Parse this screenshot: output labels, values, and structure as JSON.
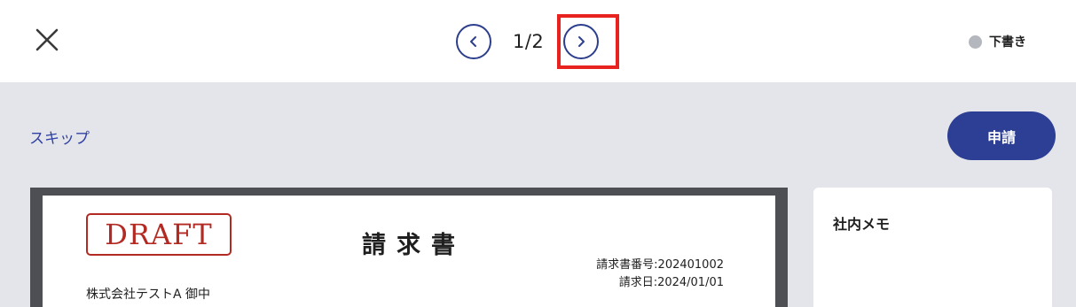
{
  "header": {
    "close_icon": "close-icon",
    "pager": {
      "prev_icon": "chevron-left-icon",
      "next_icon": "chevron-right-icon",
      "indicator": "1/2"
    },
    "status": {
      "label": "下書き",
      "dot_color": "#b5b7be"
    }
  },
  "toolbar": {
    "skip_label": "スキップ",
    "apply_label": "申請",
    "accent_color": "#2d3f94"
  },
  "document": {
    "stamp": "DRAFT",
    "title": "請求書",
    "invoice_number": "請求書番号:202401002",
    "invoice_date": "請求日:2024/01/01",
    "recipient": "株式会社テストA 御中"
  },
  "memo": {
    "title": "社内メモ"
  },
  "highlight_color": "#e8231f"
}
